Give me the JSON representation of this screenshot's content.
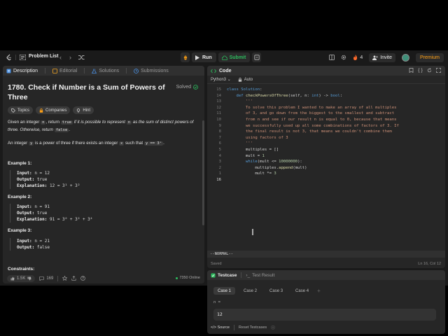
{
  "topbar": {
    "problem_list": "Problem List",
    "run": "Run",
    "submit": "Submit",
    "streak": "4",
    "invite": "Invite",
    "premium": "Premium"
  },
  "tabs": {
    "description": "Description",
    "editorial": "Editorial",
    "solutions": "Solutions",
    "submissions": "Submissions"
  },
  "problem": {
    "title": "1780. Check if Number is a Sum of Powers of Three",
    "status": "Solved",
    "chips": [
      "Topics",
      "Companies",
      "Hint"
    ],
    "desc_p1_a": "Given an integer ",
    "desc_p1_n": "n",
    "desc_p1_b": ", return ",
    "desc_p1_true": "true",
    "desc_p1_c": " if it is possible to represent ",
    "desc_p1_n2": "n",
    "desc_p1_d": " as the sum of distinct powers of three. Otherwise, return ",
    "desc_p1_false": "false",
    "desc_p1_e": ".",
    "desc_p2_a": "An integer ",
    "desc_p2_y": "y",
    "desc_p2_b": " is a power of three if there exists an integer ",
    "desc_p2_x": "x",
    "desc_p2_c": " such that ",
    "desc_p2_eq": "y == 3ˣ",
    "desc_p2_d": ".",
    "examples": [
      {
        "head": "Example 1:",
        "input": "n = 12",
        "output": "true",
        "explanation": "12 = 3¹ + 3²"
      },
      {
        "head": "Example 2:",
        "input": "n = 91",
        "output": "true",
        "explanation": "91 = 3⁰ + 3² + 3⁴"
      },
      {
        "head": "Example 3:",
        "input": "n = 21",
        "output": "false"
      }
    ],
    "input_label": "Input:",
    "output_label": "Output:",
    "explanation_label": "Explanation:",
    "constraints": "Constraints:"
  },
  "bottom": {
    "likes": "1.5K",
    "comments": "169",
    "online": "7350 Online"
  },
  "code": {
    "header": "Code",
    "language": "Python3",
    "auto": "Auto",
    "lines": [
      {
        "n": "15",
        "text": "class Solution:"
      },
      {
        "n": "14",
        "text": "    def checkPowersOfThree(self, n: int) -> bool:"
      },
      {
        "n": "13",
        "text": "        '''"
      },
      {
        "n": "12",
        "text": "        To solve this problem I wanted to make an array of all multiples"
      },
      {
        "n": "11",
        "text": "        of 3, and go down from the biggest to the smallest and subtract"
      },
      {
        "n": "10",
        "text": "        from n and see if our result n is equal to 0, because that means"
      },
      {
        "n": "9",
        "text": "        we successfully used up all some combinations of factors of 3. If"
      },
      {
        "n": "8",
        "text": "        the final result is not 3, that means we couldn't combine them"
      },
      {
        "n": "7",
        "text": "        using factors of 3"
      },
      {
        "n": "6",
        "text": "        '''"
      },
      {
        "n": "5",
        "text": "        multiples = []"
      },
      {
        "n": "4",
        "text": "        mult = 1"
      },
      {
        "n": "3",
        "text": "        while(mult <= 10000000):"
      },
      {
        "n": "2",
        "text": "            multiples.append(mult)"
      },
      {
        "n": "1",
        "text": "            mult *= 3"
      },
      {
        "n": "16",
        "text": ""
      }
    ],
    "mode": "--NORMAL--",
    "saved": "Saved",
    "position": "Ln 16, Col 12"
  },
  "testcase": {
    "tab_testcase": "Testcase",
    "tab_result": "Test Result",
    "cases": [
      "Case 1",
      "Case 2",
      "Case 3",
      "Case 4"
    ],
    "var_label": "n =",
    "var_value": "12",
    "source": "Source",
    "reset": "Reset Testcases"
  }
}
